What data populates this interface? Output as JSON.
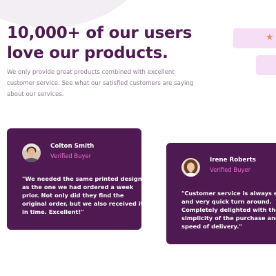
{
  "hero": {
    "headline_lines": [
      "10,000+ of our users",
      "love our products."
    ],
    "intro_lines": [
      "We only provide great products combined with excellent",
      "customer service. See what our satisfied customers are saying",
      "about our services."
    ]
  },
  "ratings": {
    "star_icon": "★",
    "star_color": "#e5934d"
  },
  "testimonials": [
    {
      "name": "Colton Smith",
      "role": "Verified Buyer",
      "quote_lines": [
        "\"We needed the same printed design",
        "as the one we had ordered a week",
        "prior. Not only did they find the",
        "original order, but we also received it",
        "in time. Excellent!\""
      ]
    },
    {
      "name": "Irene Roberts",
      "role": "Verified Buyer",
      "quote_lines": [
        "\"Customer service is always excellent",
        "and very quick turn around.",
        "Completely delighted with the",
        "simplicity of the purchase and the",
        "speed of delivery.\""
      ]
    }
  ],
  "colors": {
    "primary": "#4e1a51",
    "accent": "#ee6bd1",
    "light_pink": "#f7def7",
    "muted_text": "#8a7a8c"
  }
}
